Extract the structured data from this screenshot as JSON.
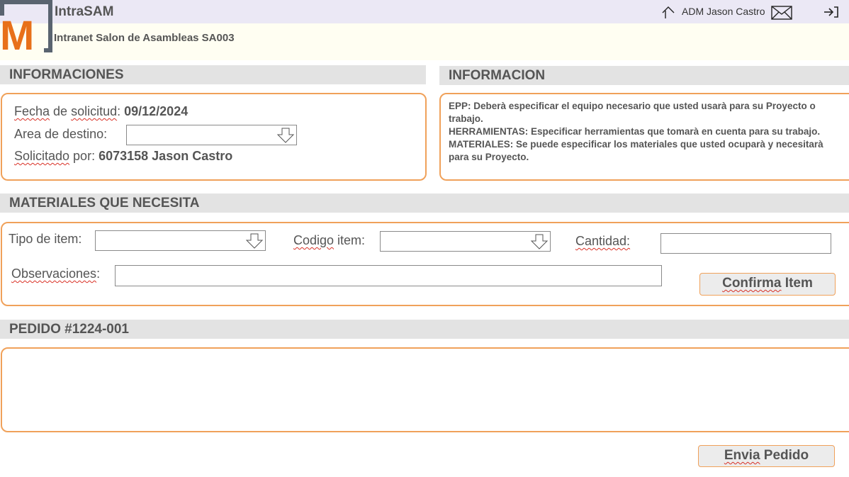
{
  "header": {
    "app_name": "IntraSAM",
    "app_subtitle": "Intranet Salon de Asambleas SA003",
    "logo_letter": "M",
    "user_name": "ADM Jason Castro",
    "icons": [
      "home-icon",
      "mail-icon",
      "logout-icon"
    ]
  },
  "informaciones": {
    "title": "INFORMACIONES",
    "fecha_label": "Fecha de solicitud:",
    "fecha_label_a": "Fecha",
    "fecha_label_b": " de ",
    "fecha_label_c": "solicitud",
    "fecha_label_d": ":",
    "fecha_value": "09/12/2024",
    "area_label": "Area de destino:",
    "area_value": "",
    "solicitado_label_a": "Solicitado",
    "solicitado_label_b": " por:",
    "solicitado_value": "6073158 Jason Castro"
  },
  "informacion": {
    "title": "INFORMACION",
    "lines": [
      "EPP: Deberà especificar el equipo necesario que usted usarà para su Proyecto o",
      "trabajo.",
      "HERRAMIENTAS: Especificar herramientas que tomarà en cuenta para su trabajo.",
      "MATERIALES: Se puede especificar los materiales que usted ocuparà y necesitarà",
      "para su Proyecto."
    ]
  },
  "materiales": {
    "title": "MATERIALES QUE NECESITA",
    "tipo_label": "Tipo de item:",
    "tipo_value": "",
    "codigo_label_a": "Codigo",
    "codigo_label_b": " item:",
    "codigo_value": "",
    "cantidad_label": "Cantidad:",
    "cantidad_value": "",
    "observaciones_label": "Observaciones",
    "observaciones_colon": ":",
    "observaciones_value": "",
    "confirm_label_a": "Confirma",
    "confirm_label_b": " Item"
  },
  "pedido": {
    "title": "PEDIDO #1224-001",
    "send_label_a": "Envia",
    "send_label_b": " Pedido"
  },
  "colors": {
    "accent_orange": "#f0a15a",
    "logo_orange": "#e8701a",
    "logo_frame": "#5a6470",
    "section_header_bg": "#e3e3e3",
    "topbar_bg": "#ebe8f5",
    "subbar_bg": "#fffef2"
  }
}
